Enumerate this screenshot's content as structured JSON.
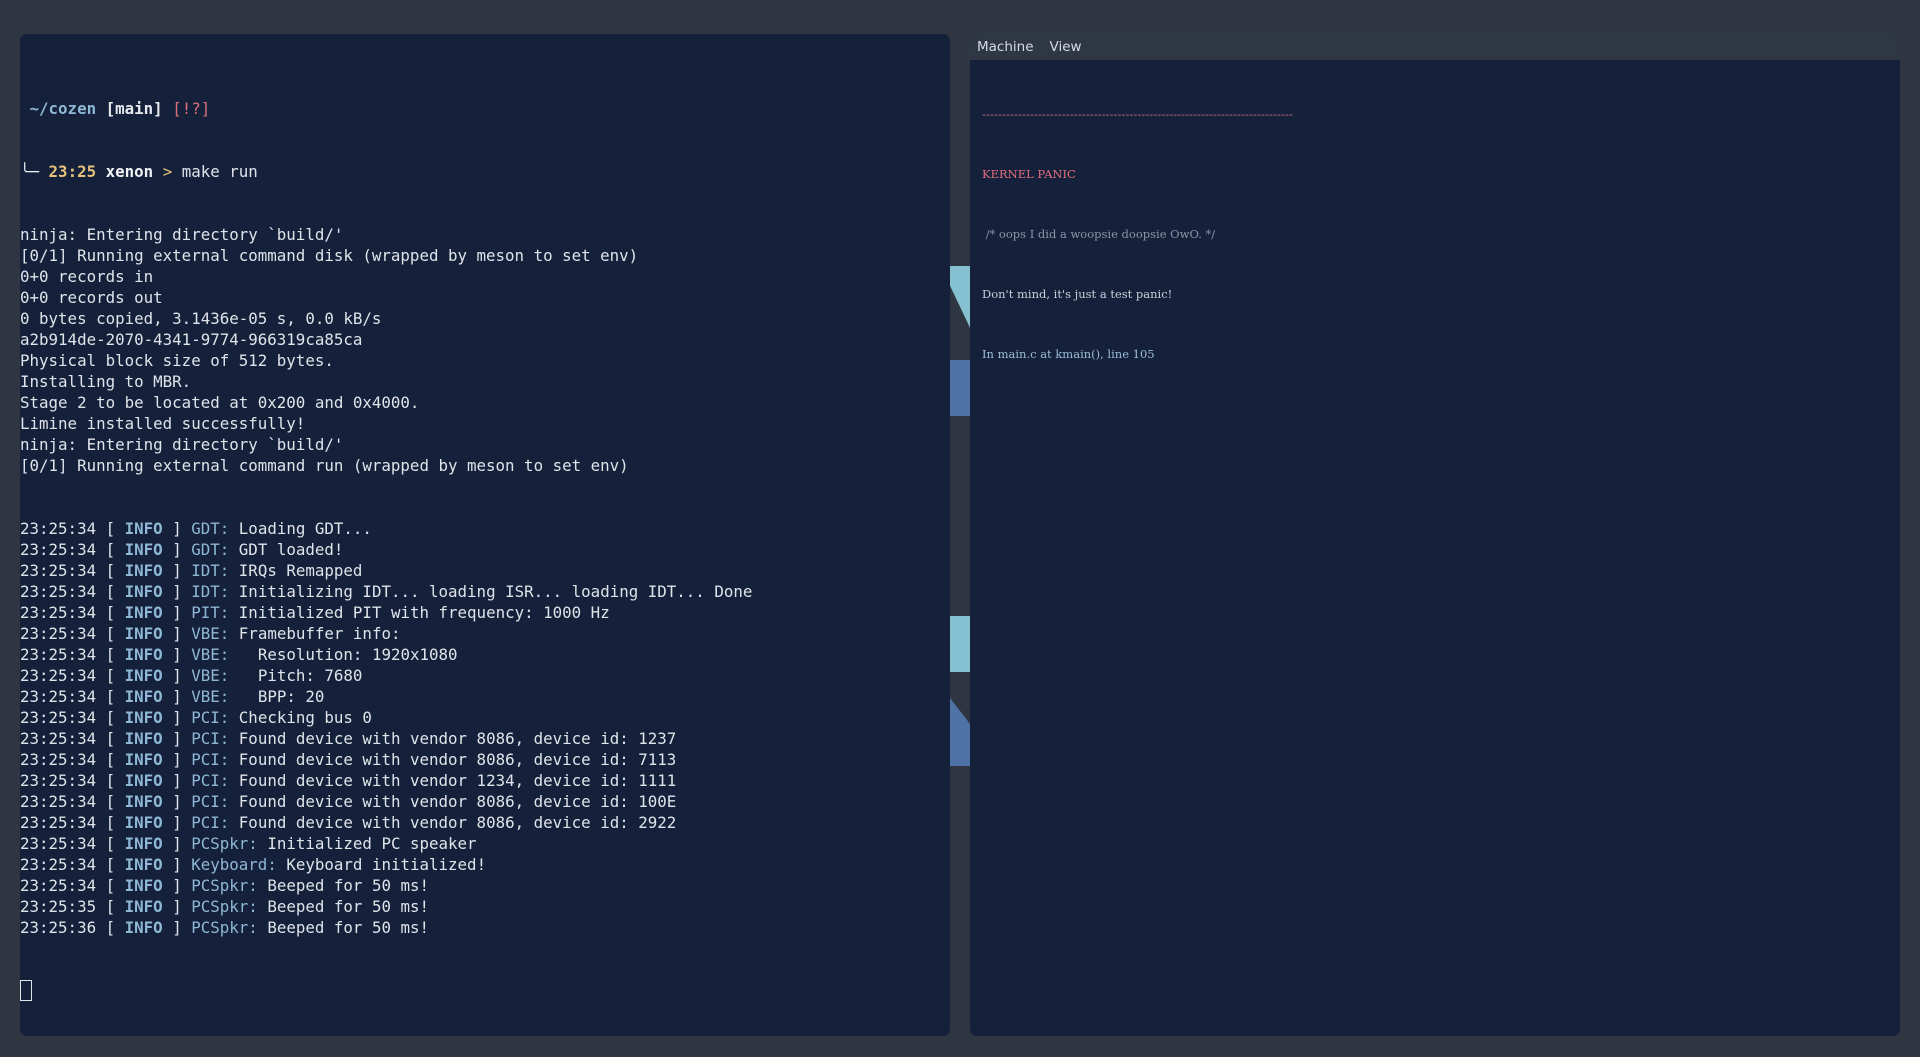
{
  "terminal": {
    "prompt": {
      "dir": "~/cozen",
      "branch": "main",
      "flags": "[!?]",
      "tree_glyph": "╰─",
      "time": "23:25",
      "host": "xenon",
      "arrow": ">",
      "command": "make run"
    },
    "output": [
      "ninja: Entering directory `build/'",
      "[0/1] Running external command disk (wrapped by meson to set env)",
      "0+0 records in",
      "0+0 records out",
      "0 bytes copied, 3.1436e-05 s, 0.0 kB/s",
      "a2b914de-2070-4341-9774-966319ca85ca",
      "Physical block size of 512 bytes.",
      "Installing to MBR.",
      "Stage 2 to be located at 0x200 and 0x4000.",
      "Limine installed successfully!",
      "ninja: Entering directory `build/'",
      "[0/1] Running external command run (wrapped by meson to set env)"
    ],
    "logs": [
      {
        "time": "23:25:34",
        "level": "INFO",
        "module": "GDT:",
        "message": "Loading GDT..."
      },
      {
        "time": "23:25:34",
        "level": "INFO",
        "module": "GDT:",
        "message": "GDT loaded!"
      },
      {
        "time": "23:25:34",
        "level": "INFO",
        "module": "IDT:",
        "message": "IRQs Remapped"
      },
      {
        "time": "23:25:34",
        "level": "INFO",
        "module": "IDT:",
        "message": "Initializing IDT... loading ISR... loading IDT... Done"
      },
      {
        "time": "23:25:34",
        "level": "INFO",
        "module": "PIT:",
        "message": "Initialized PIT with frequency: 1000 Hz"
      },
      {
        "time": "23:25:34",
        "level": "INFO",
        "module": "VBE:",
        "message": "Framebuffer info:"
      },
      {
        "time": "23:25:34",
        "level": "INFO",
        "module": "VBE:",
        "message": "  Resolution: 1920x1080"
      },
      {
        "time": "23:25:34",
        "level": "INFO",
        "module": "VBE:",
        "message": "  Pitch: 7680"
      },
      {
        "time": "23:25:34",
        "level": "INFO",
        "module": "VBE:",
        "message": "  BPP: 20"
      },
      {
        "time": "23:25:34",
        "level": "INFO",
        "module": "PCI:",
        "message": "Checking bus 0"
      },
      {
        "time": "23:25:34",
        "level": "INFO",
        "module": "PCI:",
        "message": "Found device with vendor 8086, device id: 1237"
      },
      {
        "time": "23:25:34",
        "level": "INFO",
        "module": "PCI:",
        "message": "Found device with vendor 8086, device id: 7113"
      },
      {
        "time": "23:25:34",
        "level": "INFO",
        "module": "PCI:",
        "message": "Found device with vendor 1234, device id: 1111"
      },
      {
        "time": "23:25:34",
        "level": "INFO",
        "module": "PCI:",
        "message": "Found device with vendor 8086, device id: 100E"
      },
      {
        "time": "23:25:34",
        "level": "INFO",
        "module": "PCI:",
        "message": "Found device with vendor 8086, device id: 2922"
      },
      {
        "time": "23:25:34",
        "level": "INFO",
        "module": "PCSpkr:",
        "message": "Initialized PC speaker"
      },
      {
        "time": "23:25:34",
        "level": "INFO",
        "module": "Keyboard:",
        "message": "Keyboard initialized!"
      },
      {
        "time": "23:25:34",
        "level": "INFO",
        "module": "PCSpkr:",
        "message": "Beeped for 50 ms!"
      },
      {
        "time": "23:25:35",
        "level": "INFO",
        "module": "PCSpkr:",
        "message": "Beeped for 50 ms!"
      },
      {
        "time": "23:25:36",
        "level": "INFO",
        "module": "PCSpkr:",
        "message": "Beeped for 50 ms!"
      }
    ]
  },
  "vm": {
    "menu": [
      "Machine",
      "View"
    ],
    "screen": {
      "rule": "------------------------------------------------------------------------------",
      "title": "KERNEL PANIC",
      "comment": " /* oops I did a woopsie doopsie OwO. */",
      "message": "Don't mind, it's just a test panic!",
      "location": "In main.c at kmain(), line 105"
    }
  },
  "colors": {
    "desktop": "#2f3541",
    "window_bg": "#15213a",
    "menubar": "#2f3644",
    "accent_blue": "#8fb8d6",
    "prompt_yellow": "#e8c27a",
    "panic_red": "#e46d7e"
  }
}
